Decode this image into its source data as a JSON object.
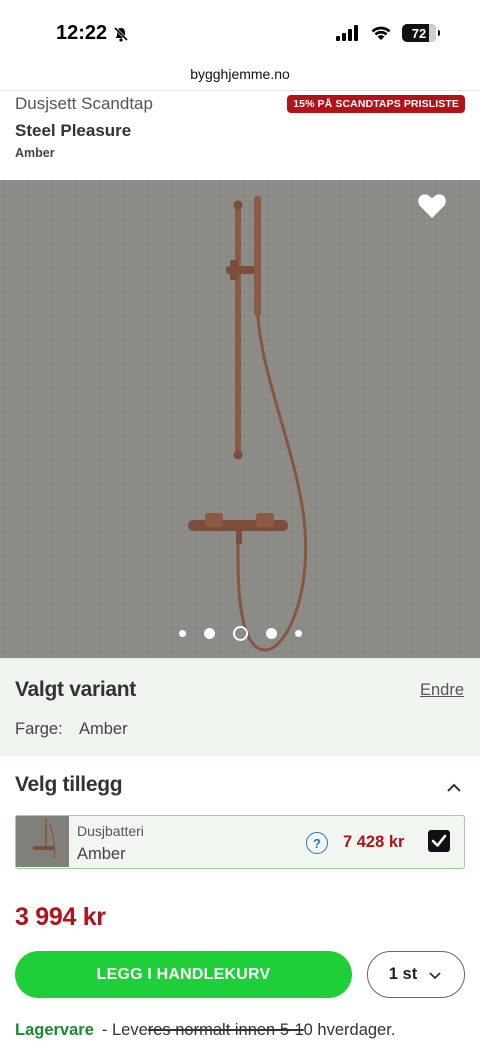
{
  "status_bar": {
    "time": "12:22",
    "battery": "72"
  },
  "browser": {
    "url": "bygghjemme.no"
  },
  "product": {
    "category": "Dusjsett Scandtap",
    "promo_badge": "15% PÅ SCANDTAPS PRISLISTE",
    "name": "Steel Pleasure",
    "variant": "Amber",
    "image_count": 5,
    "active_image_index": 2
  },
  "variant_section": {
    "title": "Valgt variant",
    "change_label": "Endre",
    "attribute_label": "Farge:",
    "attribute_value": "Amber"
  },
  "addons": {
    "title": "Velg tillegg",
    "items": [
      {
        "category": "Dusjbatteri",
        "variant": "Amber",
        "info_label": "?",
        "price": "7 428 kr",
        "selected": true
      }
    ]
  },
  "purchase": {
    "price": "3 994 kr",
    "add_to_cart_label": "LEGG I HANDLEKURV",
    "quantity": "1 st"
  },
  "stock": {
    "status": "Lagervare",
    "prefix": "- Leve",
    "struck_text": "res normalt innen 5-1",
    "suffix": "0 hverdager."
  },
  "colors": {
    "accent_green": "#1fcf3a",
    "price_red": "#b3121a",
    "stock_green": "#1a8a30",
    "copper": "#8c5a44"
  }
}
